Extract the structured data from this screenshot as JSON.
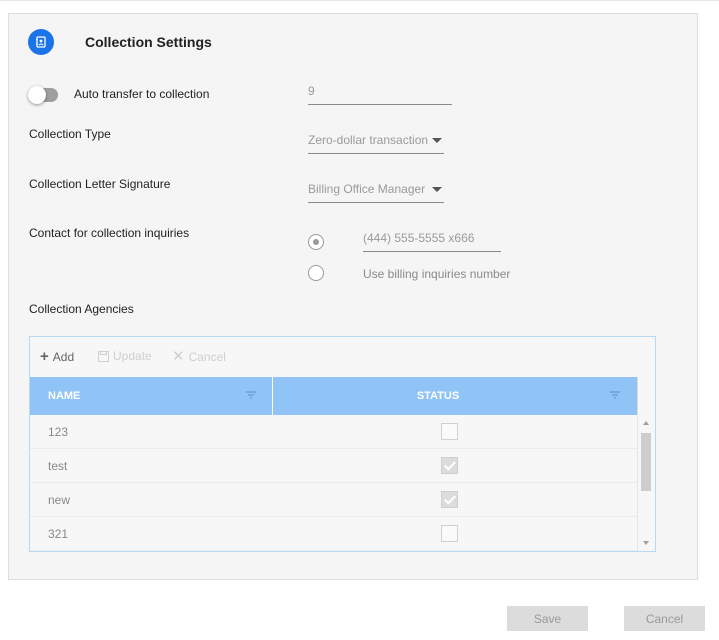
{
  "header": {
    "title": "Collection Settings",
    "icon": "contact-book-icon"
  },
  "auto_transfer": {
    "label": "Auto transfer to collection",
    "enabled": false,
    "days_value": "9"
  },
  "collection_type": {
    "label": "Collection Type",
    "value": "Zero-dollar transaction"
  },
  "letter_signature": {
    "label": "Collection Letter Signature",
    "value": "Billing Office Manager"
  },
  "contact": {
    "label": "Contact for collection inquiries",
    "phone_value": "(444) 555-5555 x666",
    "alt_option_label": "Use billing inquiries number",
    "selected": "phone"
  },
  "agencies": {
    "label": "Collection Agencies",
    "toolbar": {
      "add": "Add",
      "update": "Update",
      "cancel": "Cancel"
    },
    "columns": {
      "name": "NAME",
      "status": "STATUS"
    },
    "rows": [
      {
        "name": "123",
        "status": false
      },
      {
        "name": "test",
        "status": true
      },
      {
        "name": "new",
        "status": true
      },
      {
        "name": "321",
        "status": false
      }
    ]
  },
  "footer": {
    "save": "Save",
    "cancel": "Cancel"
  },
  "colors": {
    "accent": "#1a73e8",
    "grid_header": "#90c3f6"
  }
}
